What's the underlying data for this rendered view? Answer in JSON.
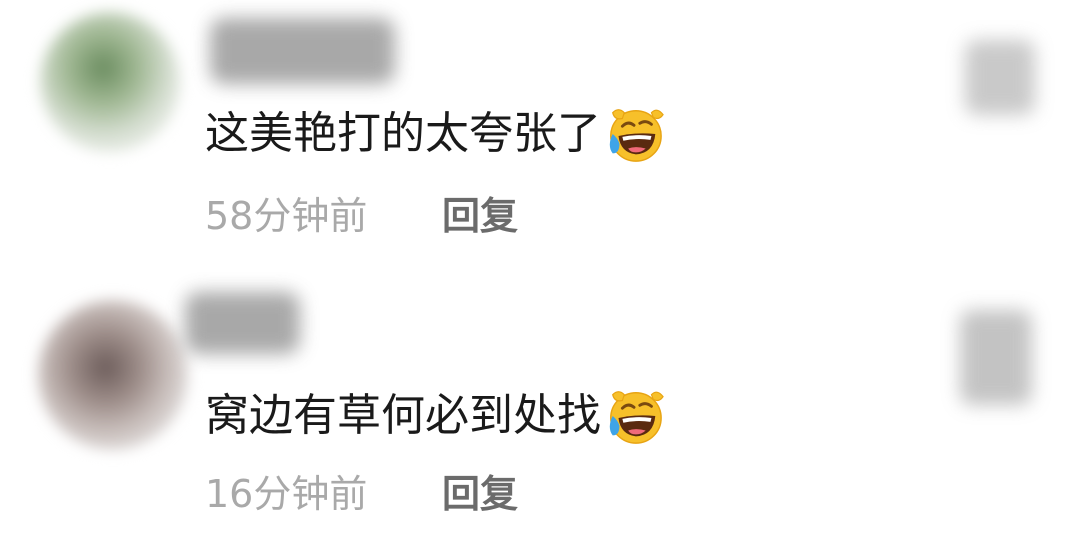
{
  "comments": [
    {
      "text": "这美艳打的太夸张了",
      "emoji_icon": "laughing-crying-face-icon",
      "time": "58分钟前",
      "reply_label": "回复"
    },
    {
      "text": "窝边有草何必到处找",
      "emoji_icon": "laughing-crying-face-icon",
      "time": "16分钟前",
      "reply_label": "回复"
    }
  ],
  "colors": {
    "comment_text": "#1a1a1a",
    "time_text": "#a9a9a9",
    "reply_text": "#6b6b6b",
    "background": "#ffffff"
  }
}
